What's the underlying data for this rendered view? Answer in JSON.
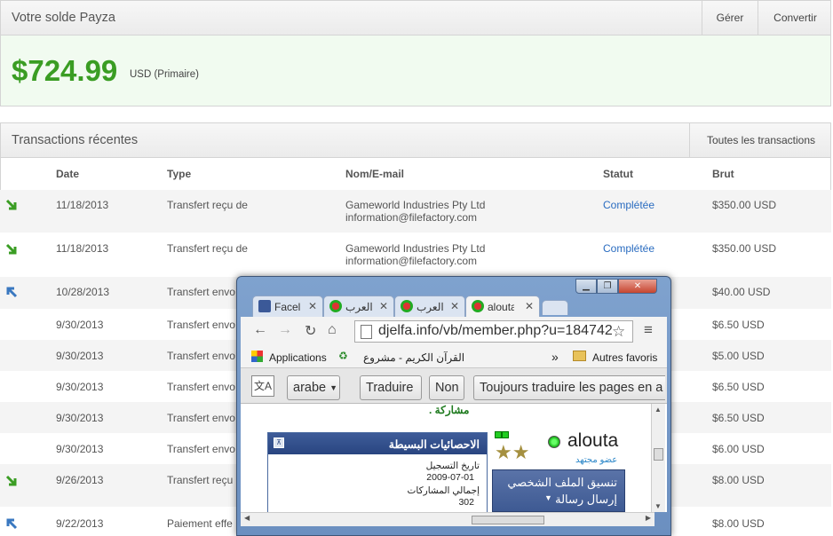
{
  "balance": {
    "title": "Votre solde Payza",
    "manage_label": "Gérer",
    "convert_label": "Convertir",
    "amount": "$724.99",
    "currency_note": "USD (Primaire)"
  },
  "transactions": {
    "title": "Transactions récentes",
    "all_label": "Toutes les transactions",
    "columns": {
      "date": "Date",
      "type": "Type",
      "name": "Nom/E-mail",
      "status": "Statut",
      "gross": "Brut"
    },
    "rows": [
      {
        "direction": "in",
        "date": "11/18/2013",
        "type": "Transfert reçu de",
        "name": "Gameworld Industries Pty Ltd",
        "email": "information@filefactory.com",
        "status": "Complétée",
        "gross": "$350.00 USD"
      },
      {
        "direction": "in",
        "date": "11/18/2013",
        "type": "Transfert reçu de",
        "name": "Gameworld Industries Pty Ltd",
        "email": "information@filefactory.com",
        "status": "Complétée",
        "gross": "$350.00 USD"
      },
      {
        "direction": "out",
        "date": "10/28/2013",
        "type": "Transfert envo",
        "name": "",
        "email": "",
        "status": "",
        "gross": "$40.00 USD"
      },
      {
        "direction": "",
        "date": "9/30/2013",
        "type": "Transfert envo",
        "name": "",
        "email": "",
        "status": "",
        "gross": "$6.50 USD"
      },
      {
        "direction": "",
        "date": "9/30/2013",
        "type": "Transfert envo",
        "name": "",
        "email": "",
        "status": "",
        "gross": "$5.00 USD"
      },
      {
        "direction": "",
        "date": "9/30/2013",
        "type": "Transfert envo",
        "name": "",
        "email": "",
        "status": "",
        "gross": "$6.50 USD"
      },
      {
        "direction": "",
        "date": "9/30/2013",
        "type": "Transfert envo",
        "name": "",
        "email": "",
        "status": "",
        "gross": "$6.50 USD"
      },
      {
        "direction": "",
        "date": "9/30/2013",
        "type": "Transfert envo",
        "name": "",
        "email": "",
        "status": "",
        "gross": "$6.00 USD"
      },
      {
        "direction": "in",
        "date": "9/26/2013",
        "type": "Transfert reçu",
        "name": "",
        "email": "",
        "status": "",
        "gross": "$8.00 USD"
      },
      {
        "direction": "out",
        "date": "9/22/2013",
        "type": "Paiement effe",
        "name": "",
        "email": "",
        "status": "",
        "gross": "$8.00 USD"
      }
    ]
  },
  "browser": {
    "tabs": [
      {
        "label": "Facel",
        "icon": "facebook-icon"
      },
      {
        "label": "العرب",
        "icon": "site-icon"
      },
      {
        "label": "العرب",
        "icon": "site-icon"
      },
      {
        "label": "alouta",
        "icon": "site-icon"
      }
    ],
    "url": "djelfa.info/vb/member.php?u=184742",
    "bookmarks": {
      "apps": "Applications",
      "item": "القرآن الكريم - مشروع",
      "more": "»",
      "other": "Autres favoris"
    },
    "translate": {
      "language": "arabe",
      "translate_label": "Traduire",
      "no_label": "Non",
      "always_label": "Toujours traduire les pages en a"
    },
    "page": {
      "top_text": "مشاركة .",
      "username": "alouta",
      "rank": "عضو مجتهد",
      "stats_title": "الاحصائيات البسيطة",
      "reg_label": "تاريخ التسجيل",
      "reg_date": "2009-07-01",
      "posts_label": "إجمالي المشاركات",
      "posts_count": "302",
      "profile_btn": "تنسيق الملف الشخصي",
      "message_btn": "إرسال رسالة"
    }
  }
}
